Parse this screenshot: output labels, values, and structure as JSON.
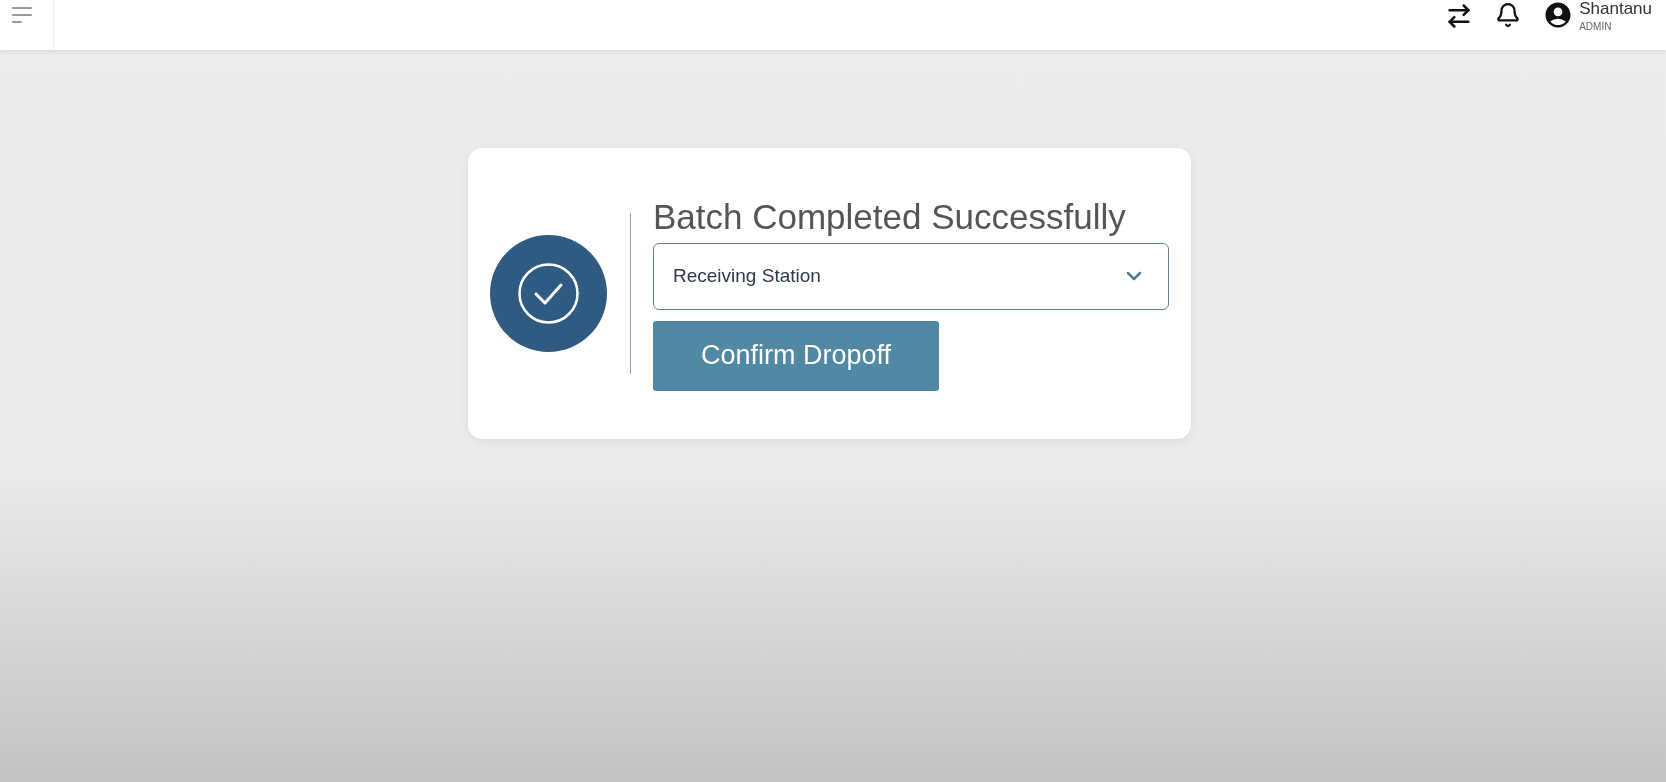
{
  "header": {
    "user": {
      "name": "Shantanu",
      "role": "ADMIN"
    }
  },
  "card": {
    "title": "Batch Completed Successfully",
    "station_select": {
      "value": "Receiving Station"
    },
    "confirm_button": {
      "label": "Confirm Dropoff"
    }
  }
}
